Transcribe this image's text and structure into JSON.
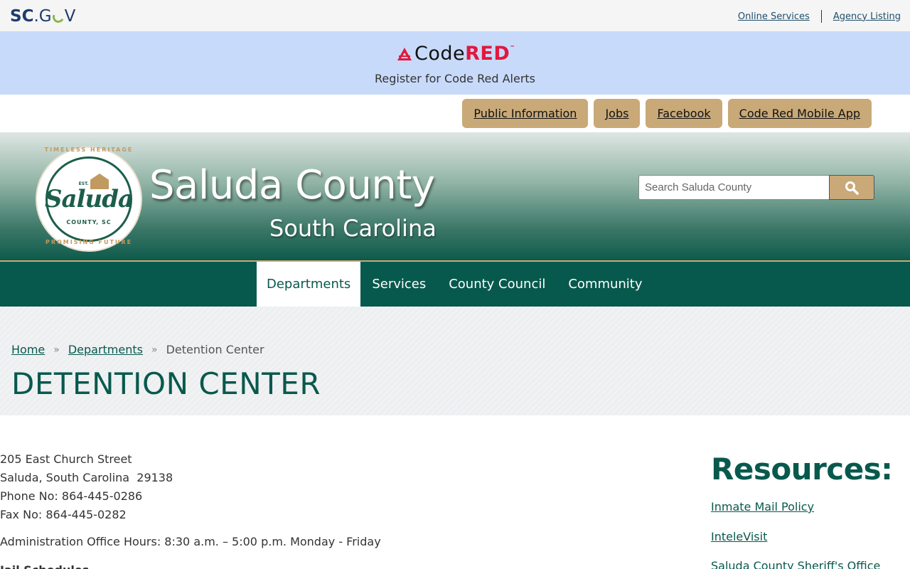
{
  "scgov": {
    "logo_sc": "SC",
    "logo_dot": ".",
    "logo_g": "G",
    "logo_v": "V",
    "links": [
      "Online Services",
      "Agency Listing"
    ]
  },
  "codered": {
    "logo_code": "Code",
    "logo_red": "RED",
    "logo_tm": "™",
    "register_text": "Register for Code Red Alerts",
    "brand_color": "#e3173e"
  },
  "quick_buttons": [
    "Public Information",
    "Jobs",
    "Facebook",
    "Code Red Mobile App"
  ],
  "seal": {
    "top_text": "TIMELESS HERITAGE",
    "est": "EST. 1896",
    "word": "Saluda",
    "county": "COUNTY, SC",
    "bottom_text": "PROMISING FUTURE"
  },
  "header": {
    "title": "Saluda County",
    "subtitle": "South Carolina",
    "search_placeholder": "Search Saluda County"
  },
  "nav": {
    "items": [
      "Departments",
      "Services",
      "County Council",
      "Community"
    ],
    "active": "Departments"
  },
  "breadcrumb": {
    "home": "Home",
    "departments": "Departments",
    "current": "Detention Center",
    "separator": "»"
  },
  "page_title": "DETENTION CENTER",
  "content": {
    "address_line1": "205 East Church Street",
    "address_line2": "Saluda, South Carolina  29138",
    "phone": "Phone No: 864-445-0286",
    "fax": "Fax No: 864-445-0282",
    "hours": "Administration Office Hours: 8:30 a.m. – 5:00 p.m. Monday - Friday",
    "cutoff_heading": "Jail Schedules"
  },
  "resources": {
    "title": "Resources:",
    "links": [
      "Inmate Mail Policy",
      "InteleVisit",
      "Saluda County Sheriff's Office"
    ]
  },
  "colors": {
    "primary_green": "#08594d",
    "tan": "#c9a978",
    "banner_blue": "#c8dafa"
  }
}
